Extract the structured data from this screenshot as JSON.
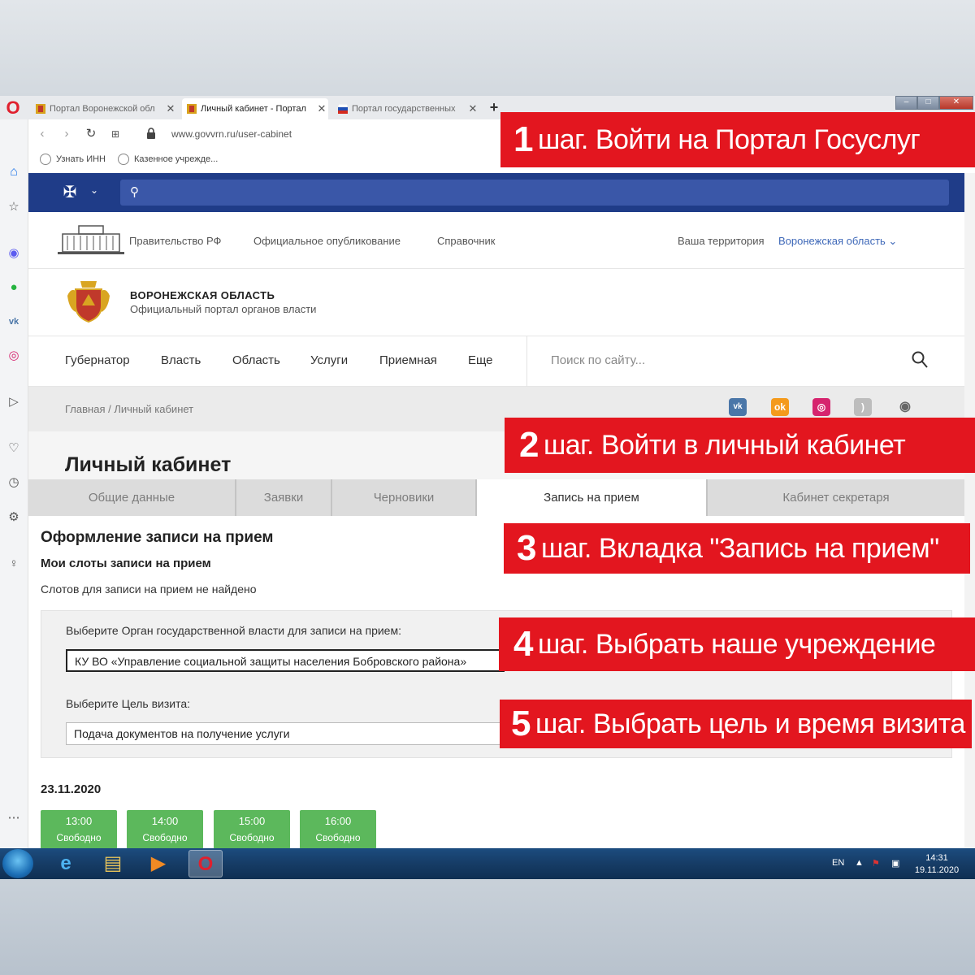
{
  "browser": {
    "tabs": [
      {
        "title": "Портал Воронежской обл"
      },
      {
        "title": "Личный кабинет - Портал"
      },
      {
        "title": "Портал государственных"
      }
    ],
    "url": "www.govvrn.ru/user-cabinet",
    "bookmarks": [
      "Узнать ИНН",
      "Казенное учрежде..."
    ]
  },
  "site": {
    "topline": {
      "links": [
        "Правительство РФ",
        "Официальное опубликование",
        "Справочник"
      ],
      "territory_label": "Ваша территория",
      "territory_value": "Воронежская область"
    },
    "brand": {
      "title": "ВОРОНЕЖСКАЯ ОБЛАСТЬ",
      "subtitle": "Официальный портал органов власти"
    },
    "menu": [
      "Губернатор",
      "Власть",
      "Область",
      "Услуги",
      "Приемная",
      "Еще"
    ],
    "search_placeholder": "Поиск по сайту...",
    "breadcrumb": "Главная  /  Личный кабинет",
    "page_title": "Личный кабинет",
    "tabs": [
      "Общие данные",
      "Заявки",
      "Черновики",
      "Запись на прием",
      "Кабинет секретаря"
    ],
    "section": {
      "title": "Оформление записи на прием",
      "subtitle": "Мои слоты записи на прием",
      "note": "Слотов для записи на прием не найдено"
    },
    "form": {
      "org_label": "Выберите Орган государственной власти для записи на прием:",
      "org_value": "КУ ВО «Управление социальной защиты населения Бобровского района»",
      "goal_label": "Выберите Цель визита:",
      "goal_value": "Подача документов на получение услуги"
    },
    "date": "23.11.2020",
    "slots": [
      {
        "time": "13:00",
        "status": "Свободно"
      },
      {
        "time": "14:00",
        "status": "Свободно"
      },
      {
        "time": "15:00",
        "status": "Свободно"
      },
      {
        "time": "16:00",
        "status": "Свободно"
      }
    ]
  },
  "steps": [
    {
      "num": "1",
      "text": "шаг. Войти на Портал Госуслуг"
    },
    {
      "num": "2",
      "text": "шаг. Войти в личный кабинет"
    },
    {
      "num": "3",
      "text": "шаг. Вкладка \"Запись на прием\""
    },
    {
      "num": "4",
      "text": "шаг. Выбрать наше учреждение"
    },
    {
      "num": "5",
      "text": "шаг. Выбрать цель и время визита"
    }
  ],
  "taskbar": {
    "lang": "EN",
    "time": "14:31",
    "date": "19.11.2020"
  },
  "colors": {
    "step_red": "#e3161f",
    "gos_blue": "#1f3c88",
    "slot_green": "#5cb85c"
  }
}
